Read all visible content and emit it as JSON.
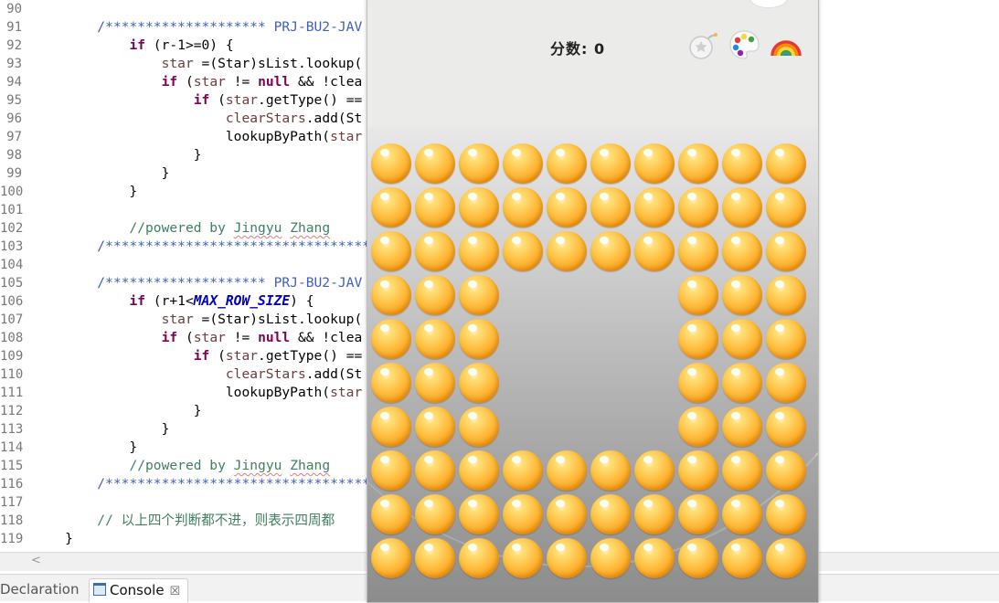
{
  "editor": {
    "lines": [
      {
        "n": "90",
        "segs": []
      },
      {
        "n": "91",
        "segs": [
          {
            "t": "        "
          },
          {
            "t": "/******************** PRJ-BU2-JAV",
            "c": "jd"
          }
        ]
      },
      {
        "n": "92",
        "segs": [
          {
            "t": "            "
          },
          {
            "t": "if",
            "c": "kw"
          },
          {
            "t": " (r-1>=0) {"
          }
        ]
      },
      {
        "n": "93",
        "segs": [
          {
            "t": "                "
          },
          {
            "t": "star",
            "c": "var"
          },
          {
            "t": " =(Star)sList.lookup("
          }
        ]
      },
      {
        "n": "94",
        "segs": [
          {
            "t": "                "
          },
          {
            "t": "if",
            "c": "kw"
          },
          {
            "t": " ("
          },
          {
            "t": "star",
            "c": "var"
          },
          {
            "t": " != "
          },
          {
            "t": "null",
            "c": "kw"
          },
          {
            "t": " && !clea"
          }
        ]
      },
      {
        "n": "95",
        "segs": [
          {
            "t": "                    "
          },
          {
            "t": "if",
            "c": "kw"
          },
          {
            "t": " ("
          },
          {
            "t": "star",
            "c": "var"
          },
          {
            "t": ".getType() =="
          }
        ]
      },
      {
        "n": "96",
        "segs": [
          {
            "t": "                        "
          },
          {
            "t": "clearStars",
            "c": "var"
          },
          {
            "t": ".add(St"
          }
        ]
      },
      {
        "n": "97",
        "segs": [
          {
            "t": "                        lookupByPath("
          },
          {
            "t": "star",
            "c": "var"
          }
        ]
      },
      {
        "n": "98",
        "segs": [
          {
            "t": "                    }"
          }
        ]
      },
      {
        "n": "99",
        "segs": [
          {
            "t": "                }"
          }
        ]
      },
      {
        "n": "100",
        "segs": [
          {
            "t": "            }"
          }
        ]
      },
      {
        "n": "101",
        "segs": []
      },
      {
        "n": "102",
        "segs": [
          {
            "t": "            "
          },
          {
            "t": "//powered by ",
            "c": "cm"
          },
          {
            "t": "Jingyu",
            "c": "cm squig"
          },
          {
            "t": " ",
            "c": "cm"
          },
          {
            "t": "Zhang",
            "c": "cm squig"
          }
        ]
      },
      {
        "n": "103",
        "segs": [
          {
            "t": "        "
          },
          {
            "t": "/************************************",
            "c": "jd"
          }
        ]
      },
      {
        "n": "104",
        "segs": []
      },
      {
        "n": "105",
        "segs": [
          {
            "t": "        "
          },
          {
            "t": "/******************** PRJ-BU2-JAV",
            "c": "jd"
          }
        ]
      },
      {
        "n": "106",
        "segs": [
          {
            "t": "            "
          },
          {
            "t": "if",
            "c": "kw"
          },
          {
            "t": " (r+1<"
          },
          {
            "t": "MAX_ROW_SIZE",
            "c": "field"
          },
          {
            "t": ") {"
          }
        ]
      },
      {
        "n": "107",
        "segs": [
          {
            "t": "                "
          },
          {
            "t": "star",
            "c": "var"
          },
          {
            "t": " =(Star)sList.lookup("
          }
        ]
      },
      {
        "n": "108",
        "segs": [
          {
            "t": "                "
          },
          {
            "t": "if",
            "c": "kw"
          },
          {
            "t": " ("
          },
          {
            "t": "star",
            "c": "var"
          },
          {
            "t": " != "
          },
          {
            "t": "null",
            "c": "kw"
          },
          {
            "t": " && !clea"
          }
        ]
      },
      {
        "n": "109",
        "segs": [
          {
            "t": "                    "
          },
          {
            "t": "if",
            "c": "kw"
          },
          {
            "t": " ("
          },
          {
            "t": "star",
            "c": "var"
          },
          {
            "t": ".getType() =="
          }
        ]
      },
      {
        "n": "110",
        "segs": [
          {
            "t": "                        "
          },
          {
            "t": "clearStars",
            "c": "var"
          },
          {
            "t": ".add(St"
          }
        ]
      },
      {
        "n": "111",
        "segs": [
          {
            "t": "                        lookupByPath("
          },
          {
            "t": "star",
            "c": "var"
          }
        ]
      },
      {
        "n": "112",
        "segs": [
          {
            "t": "                    }"
          }
        ]
      },
      {
        "n": "113",
        "segs": [
          {
            "t": "                }"
          }
        ]
      },
      {
        "n": "114",
        "segs": [
          {
            "t": "            }"
          }
        ]
      },
      {
        "n": "115",
        "segs": [
          {
            "t": "            "
          },
          {
            "t": "//powered by ",
            "c": "cm"
          },
          {
            "t": "Jingyu",
            "c": "cm squig"
          },
          {
            "t": " ",
            "c": "cm"
          },
          {
            "t": "Zhang",
            "c": "cm squig"
          }
        ]
      },
      {
        "n": "116",
        "segs": [
          {
            "t": "        "
          },
          {
            "t": "/************************************",
            "c": "jd"
          }
        ]
      },
      {
        "n": "117",
        "segs": []
      },
      {
        "n": "118",
        "segs": [
          {
            "t": "        "
          },
          {
            "t": "// 以上四个判断都不进，则表示四周都",
            "c": "cm"
          }
        ]
      },
      {
        "n": "119",
        "segs": [
          {
            "t": "    }"
          }
        ]
      }
    ]
  },
  "hscroll": {
    "arrow": "<"
  },
  "tabs": {
    "declaration": "Declaration",
    "console": "Console",
    "close": "☒"
  },
  "game": {
    "score_text": "分数: 0",
    "tools": [
      "bomb",
      "palette",
      "rainbow"
    ],
    "star_color": "#f7a11a",
    "grid": [
      "1111111111",
      "1111111111",
      "1111111111",
      "1110000111",
      "1110000111",
      "1110000111",
      "1110000111",
      "1111111111",
      "1111111111",
      "1111111111"
    ]
  }
}
